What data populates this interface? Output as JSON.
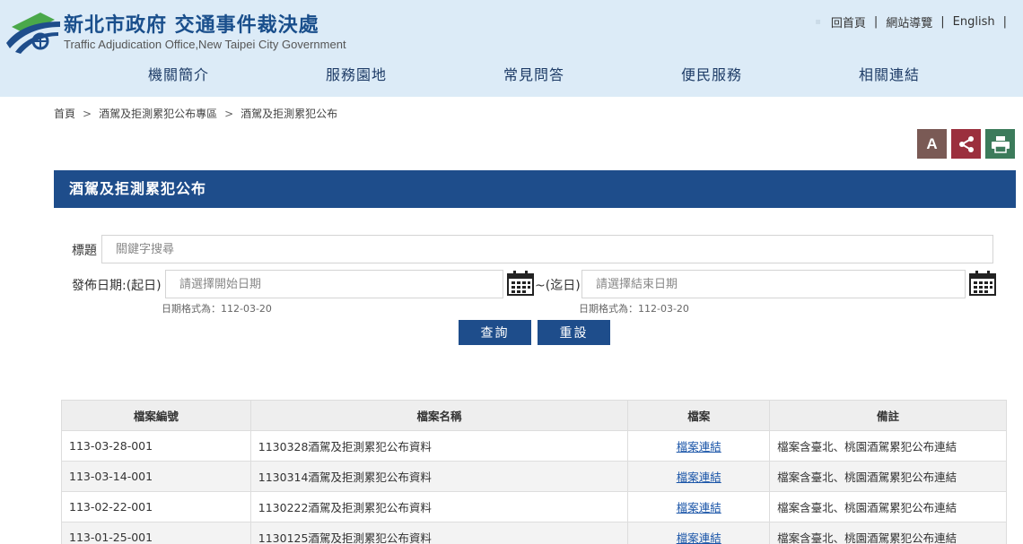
{
  "header": {
    "title": "新北市政府 交通事件裁決處",
    "subtitle": "Traffic Adjudication Office,New Taipei City Government",
    "top_links": [
      "回首頁",
      "網站導覽",
      "English"
    ],
    "nav": [
      "機關簡介",
      "服務園地",
      "常見問答",
      "便民服務",
      "相關連結"
    ]
  },
  "breadcrumb": [
    "首頁",
    "酒駕及拒測累犯公布專區",
    "酒駕及拒測累犯公布"
  ],
  "tools": {
    "font_label": "A"
  },
  "section_title": "酒駕及拒測累犯公布",
  "form": {
    "title_label": "標題",
    "title_placeholder": "關鍵字搜尋",
    "date_label": "發佈日期:(起日)",
    "start_placeholder": "請選擇開始日期",
    "tilde_label": "~(迄日)",
    "end_placeholder": "請選擇結束日期",
    "date_hint": "日期格式為：112-03-20",
    "search_button": "查詢",
    "reset_button": "重設"
  },
  "table": {
    "headers": [
      "檔案編號",
      "檔案名稱",
      "檔案",
      "備註"
    ],
    "rows": [
      {
        "id": "113-03-28-001",
        "name": "1130328酒駕及拒測累犯公布資料",
        "link": "檔案連結",
        "note": "檔案含臺北、桃園酒駕累犯公布連結"
      },
      {
        "id": "113-03-14-001",
        "name": "1130314酒駕及拒測累犯公布資料",
        "link": "檔案連結",
        "note": "檔案含臺北、桃園酒駕累犯公布連結"
      },
      {
        "id": "113-02-22-001",
        "name": "1130222酒駕及拒測累犯公布資料",
        "link": "檔案連結",
        "note": "檔案含臺北、桃園酒駕累犯公布連結"
      },
      {
        "id": "113-01-25-001",
        "name": "1130125酒駕及拒測累犯公布資料",
        "link": "檔案連結",
        "note": "檔案含臺北、桃園酒駕累犯公布連結"
      }
    ]
  },
  "colors": {
    "header_bg": "#dcebf7",
    "brand_blue": "#1e4d8b",
    "font_btn": "#7a5a55",
    "share_btn": "#9b2f3d",
    "print_btn": "#3c7b5b"
  },
  "icons": [
    "logo-icon",
    "share-icon",
    "print-icon",
    "calendar-icon"
  ]
}
